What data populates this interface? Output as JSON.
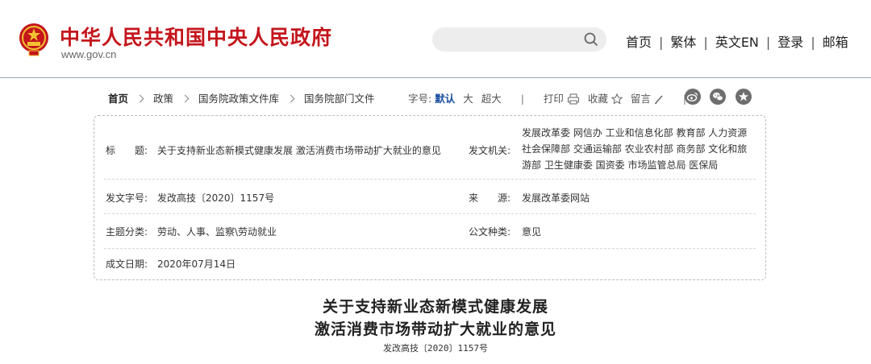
{
  "header": {
    "site_title": "中华人民共和国中央人民政府",
    "site_url": "www.gov.cn",
    "brand_color": "#c4161c",
    "nav": [
      "首页",
      "繁体",
      "英文EN",
      "登录",
      "邮箱"
    ],
    "nav_separator": "|"
  },
  "breadcrumb": {
    "items": [
      "首页",
      "政策",
      "国务院政策文件库",
      "国务院部门文件"
    ]
  },
  "tools": {
    "font_size_label": "字号:",
    "font_default": "默认",
    "font_large": "大",
    "font_xlarge": "超大",
    "separator": "|",
    "print": "打印",
    "favorite": "收藏",
    "comment": "留言",
    "social_icons": [
      "weibo-icon",
      "wechat-icon",
      "star-icon"
    ]
  },
  "info": {
    "title_label": "标　　题:",
    "title_value": "关于支持新业态新模式健康发展 激活消费市场带动扩大就业的意见",
    "issuer_label": "发文机关:",
    "issuer_value": "发展改革委 网信办 工业和信息化部 教育部 人力资源社会保障部 交通运输部 农业农村部 商务部 文化和旅游部 卫生健康委 国资委 市场监管总局 医保局",
    "doc_no_label": "发文字号:",
    "doc_no_value": "发改高技〔2020〕1157号",
    "source_label": "来　　源:",
    "source_value": "发展改革委网站",
    "topic_label": "主题分类:",
    "topic_value": "劳动、人事、监察\\劳动就业",
    "type_label": "公文种类:",
    "type_value": "意见",
    "date_label": "成文日期:",
    "date_value": "2020年07月14日"
  },
  "article": {
    "title_line1": "关于支持新业态新模式健康发展",
    "title_line2": "激活消费市场带动扩大就业的意见",
    "doc_number": "发改高技〔2020〕1157号"
  }
}
